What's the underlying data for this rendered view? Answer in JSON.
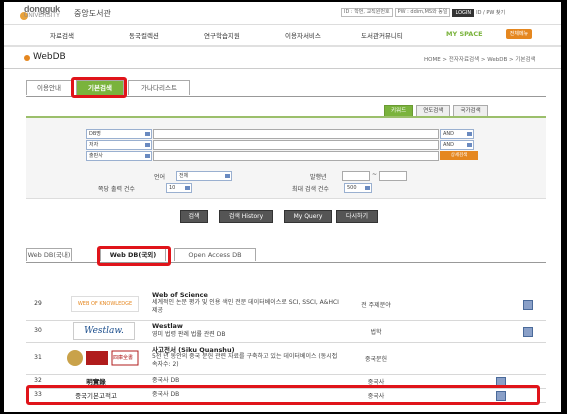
{
  "header": {
    "logo_text": "dongguk",
    "logo_sub": "UNIVERSITY",
    "library_name": "중앙도서관",
    "login": {
      "id_placeholder": "ID : 학번, 교직원번호",
      "pw_placeholder": "PW : ddim,MS와 동일",
      "login_button": "LOGIN",
      "id_pw_lookup": "ID / PW 찾기"
    }
  },
  "nav": {
    "items": [
      "자료검색",
      "동국컬렉션",
      "연구학습지원",
      "이용자서비스",
      "도서관커뮤니티"
    ],
    "my_space": "MY SPACE",
    "help_button": "전체메뉴"
  },
  "page": {
    "title": "WebDB",
    "breadcrumb": "HOME > 전자자료검색 > WebDB > 기본검색"
  },
  "tabs_top": [
    "이용안내",
    "기본검색",
    "가나다리스트"
  ],
  "sub_tabs": [
    "키워드",
    "연도검색",
    "국가검색"
  ],
  "search": {
    "rows": [
      {
        "field": "DB명",
        "op": "AND"
      },
      {
        "field": "저자",
        "op": "AND"
      },
      {
        "field": "출판사",
        "op": ""
      }
    ],
    "detail_button": "상세검색",
    "language_label": "언어",
    "language_value": "전체",
    "year_label": "발행년",
    "year_sep": "~",
    "per_page_label": "쪽당 출력 건수",
    "per_page_value": "10",
    "max_label": "최대 검색 건수",
    "max_value": "500"
  },
  "actions": [
    "검색",
    "검색 History",
    "My Query",
    "다시하기"
  ],
  "tabs_db": [
    "Web DB(국내)",
    "Web DB(국외)",
    "Open Access DB"
  ],
  "results": [
    {
      "num": "29",
      "logo": "WEB OF KNOWLEDGE",
      "title": "Web of Science",
      "desc": "세계적인 논문 평가 및 인용 색인 전문 데이터베이스로 SCI, SSCI, A&HCI 제공",
      "category": "전 주제분야"
    },
    {
      "num": "30",
      "logo": "Westlaw.",
      "title": "Westlaw",
      "desc": "영미 법령 판례 법률 관련 DB",
      "category": "법학"
    },
    {
      "num": "31",
      "logo": "四庫全書",
      "title": "사고전서 (Siku Quanshu)",
      "desc": "5천 년 동안의 중국 문헌 관련 자료를 구축하고 있는 데이터베이스 (동시접속자수: 2)",
      "category": "중국문헌"
    },
    {
      "num": "32",
      "name": "明實錄",
      "desc": "중국사 DB",
      "category": "중국사"
    },
    {
      "num": "33",
      "name": "중국기본고적고",
      "desc": "중국사 DB",
      "category": "중국사"
    }
  ],
  "colors": {
    "accent_green": "#7ab33c",
    "accent_orange": "#e5871f",
    "highlight_red": "#e0141a"
  }
}
